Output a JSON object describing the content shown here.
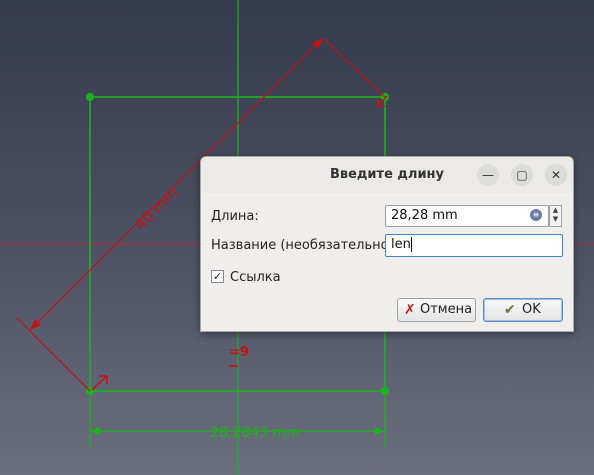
{
  "dialog": {
    "title": "Введите длину",
    "minimize_glyph": "—",
    "maximize_glyph": "▢",
    "close_glyph": "✕",
    "length_label": "Длина:",
    "length_value": "28,28 mm",
    "name_label": "Название (необязательно)",
    "name_value": "len",
    "reference_label": "Ссылка",
    "reference_checked": true,
    "check_glyph": "✓",
    "cancel_label": "Отмена",
    "ok_label": "OK",
    "spin_up": "▲",
    "spin_down": "▼"
  },
  "sketch": {
    "diagonal_dimension": "40 mm",
    "horizontal_dimension": "28,2843 mm",
    "constraint_symbol": "=9",
    "line_color": "#1db31d",
    "dimension_color": "#c01414",
    "axis_color": "#b52d2d"
  },
  "icons": {
    "cancel": "cancel-x-icon",
    "ok": "ok-hand-icon",
    "unit": "unit-expression-icon"
  }
}
